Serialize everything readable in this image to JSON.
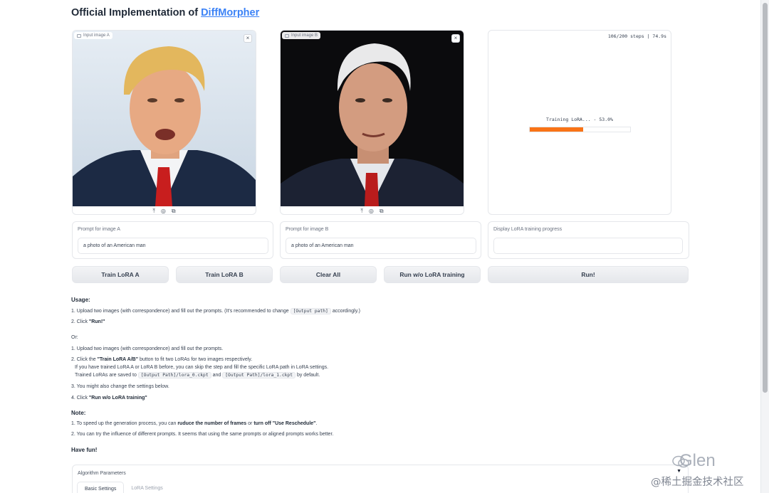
{
  "header": {
    "title_prefix": "Official Implementation of",
    "title_link": "DiffMorpher"
  },
  "image_a": {
    "label": "Input image A",
    "close": "×"
  },
  "image_b": {
    "label": "Input image B",
    "close": "×"
  },
  "image_tools": {
    "upload": "⤒",
    "webcam": "◎",
    "clipboard": "⧉"
  },
  "progress": {
    "steps": "106/200 steps | 74.9s",
    "training_text": "Training LoRA... - 53.0%",
    "percent": 53
  },
  "prompts": [
    {
      "label": "Prompt for image A",
      "value": "a photo of an American man"
    },
    {
      "label": "Prompt for image B",
      "value": "a photo of an American man"
    },
    {
      "label": "Display LoRA training progress",
      "value": ""
    }
  ],
  "buttons": {
    "train_a": "Train LoRA A",
    "train_b": "Train LoRA B",
    "clear": "Clear All",
    "run_wo": "Run w/o LoRA training",
    "run": "Run!"
  },
  "usage": {
    "heading": "Usage:",
    "step1_a": "1. Upload two images (with correspondence) and fill out the prompts. (It's recommended to change",
    "step1_code": "[Output path]",
    "step1_b": "accordingly.)",
    "step2_a": "2. Click",
    "step2_b": "\"Run!\"",
    "or": "Or:",
    "alt1": "1. Upload two images (with correspondence) and fill out the prompts.",
    "alt2_a": "2. Click the",
    "alt2_b": "\"Train LoRA A/B\"",
    "alt2_c": "button to fit two LoRAs for two images respectively.",
    "alt2_line2": "If you have trained LoRA A or LoRA B before, you can skip the step and fill the specific LoRA path in LoRA settings.",
    "alt2_line3_a": "Trained LoRAs are saved to",
    "alt2_code1": "[Output Path]/lora_0.ckpt",
    "alt2_and": "and",
    "alt2_code2": "[Output Path]/lora_1.ckpt",
    "alt2_line3_b": "by default.",
    "alt3": "3. You might also change the settings below.",
    "alt4_a": "4. Click",
    "alt4_b": "\"Run w/o LoRA training\"",
    "note_heading": "Note:",
    "note1_a": "1. To speed up the generation process, you can",
    "note1_b": "ruduce the number of frames",
    "note1_c": "or",
    "note1_d": "turn off \"Use Reschedule\"",
    "note1_e": ".",
    "note2": "2. You can try the influence of different prompts. It seems that using the same prompts or aligned prompts works better.",
    "fun": "Have fun!"
  },
  "algorithm": {
    "title": "Algorithm Parameters",
    "chevron": "▼",
    "tabs": [
      "Basic Settings",
      "LoRA Settings"
    ]
  },
  "watermark": {
    "name": "Glen",
    "site": "@稀土掘金技术社区"
  }
}
